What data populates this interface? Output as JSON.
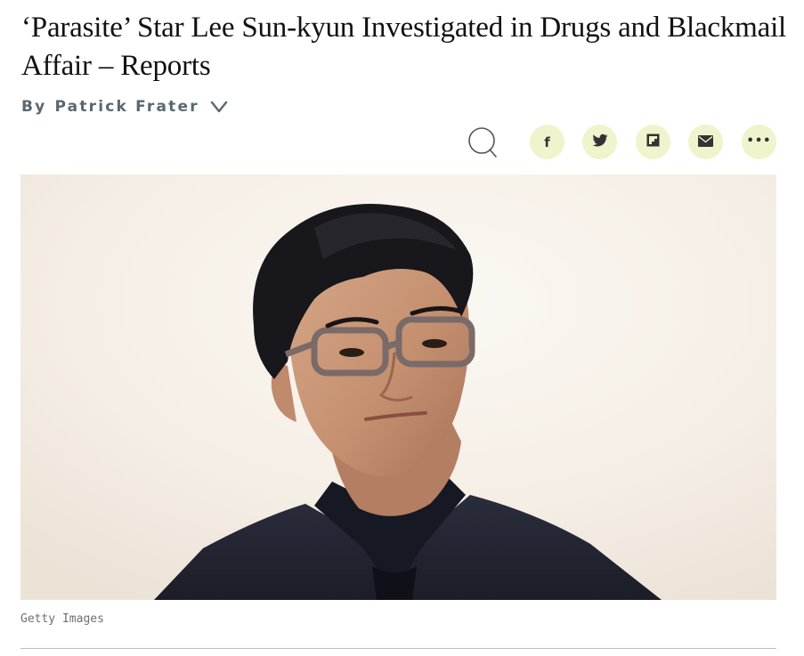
{
  "article": {
    "headline": "‘Parasite’ Star Lee Sun-kyun Investigated in Drugs and Blackmail Affair – Reports",
    "byline_prefix": "By",
    "author": "Patrick Frater"
  },
  "share": {
    "comment_icon": "comment-bubble-icon",
    "buttons": [
      {
        "icon": "facebook-icon",
        "glyph": "f"
      },
      {
        "icon": "twitter-icon"
      },
      {
        "icon": "flipboard-icon"
      },
      {
        "icon": "email-icon"
      },
      {
        "icon": "more-icon",
        "glyph": "•••"
      }
    ],
    "button_color": "#f0f3cc"
  },
  "image": {
    "credit": "Getty Images"
  }
}
